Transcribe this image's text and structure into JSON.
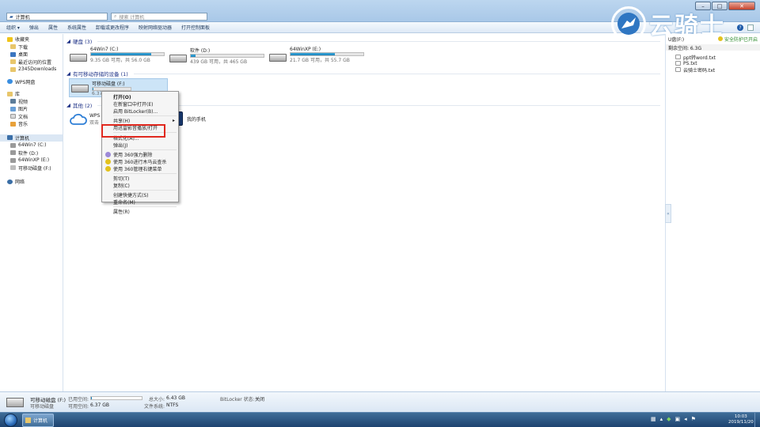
{
  "window": {
    "address": "计算机",
    "search_placeholder": "搜索 计算机"
  },
  "toolbar": [
    "组织 ▾",
    "弹出",
    "属性",
    "系统属性",
    "卸载或更改程序",
    "映射网络驱动器",
    "打开控制面板"
  ],
  "nav": {
    "favorites": [
      "收藏夹",
      "下载",
      "桌面",
      "最近访问的位置",
      "2345Downloads"
    ],
    "wps": "WPS网盘",
    "libraries": [
      "库",
      "视频",
      "图片",
      "文档",
      "音乐"
    ],
    "computer": "计算机",
    "drives": [
      "64Win7 (C:)",
      "软件 (D:)",
      "64WinXP (E:)",
      "可移动磁盘 (F:)"
    ],
    "network": "网络"
  },
  "groups": {
    "hard_disks": "硬盘 (3)",
    "removable": "有可移动存储的设备 (1)",
    "other": "其他 (2)"
  },
  "drives": [
    {
      "name": "64Win7 (C:)",
      "free": "9.35 GB 可用，共 56.0 GB",
      "used_fraction": 0.83
    },
    {
      "name": "软件 (D:)",
      "free": "439 GB 可用，共 465 GB",
      "used_fraction": 0.06
    },
    {
      "name": "64WinXP (E:)",
      "free": "21.7 GB 可用，共 55.7 GB",
      "used_fraction": 0.61
    }
  ],
  "removable": {
    "name": "可移动磁盘 (F:)",
    "free": "6.37"
  },
  "other": {
    "wps": "WPS",
    "wps_sub": "双击",
    "phone": "我的手机"
  },
  "context_menu": {
    "items": [
      "打开(O)",
      "在新窗口中打开(E)",
      "启用 BitLocker(B)...",
      "共享(H)",
      "用迅雷影音播放/打开",
      "格式化(A)...",
      "弹出(J)",
      "使用 360强力删除",
      "使用 360进行木马云查杀",
      "使用 360管理右键菜单",
      "剪切(T)",
      "复制(C)",
      "创建快捷方式(S)",
      "重命名(M)",
      "属性(R)"
    ]
  },
  "preview": {
    "drive": "U盘(F:)",
    "security": "安全防护已开启",
    "space": "剩余空间: 6.3G",
    "files": [
      "ppt转word.txt",
      "PS.txt",
      "云骑士密码.txt"
    ]
  },
  "brand": {
    "text": "云骑士"
  },
  "details": {
    "name": "可移动磁盘 (F:)",
    "type": "可移动磁盘",
    "used_label": "已用空间:",
    "free_label": "可用空间:",
    "free_value": "6.37 GB",
    "used_fraction": 0.01,
    "total_label": "总大小:",
    "total_value": "6.43 GB",
    "fs_label": "文件系统:",
    "fs_value": "NTFS",
    "bitlocker_label": "BitLocker 状态:",
    "bitlocker_value": "关闭"
  },
  "taskbar": {
    "task": "计算机",
    "time": "10:03",
    "date": "2019/11/20"
  },
  "colors": {
    "accent": "#1a83be",
    "highlight": "#e0281e",
    "taskbar": "#1d4370"
  }
}
